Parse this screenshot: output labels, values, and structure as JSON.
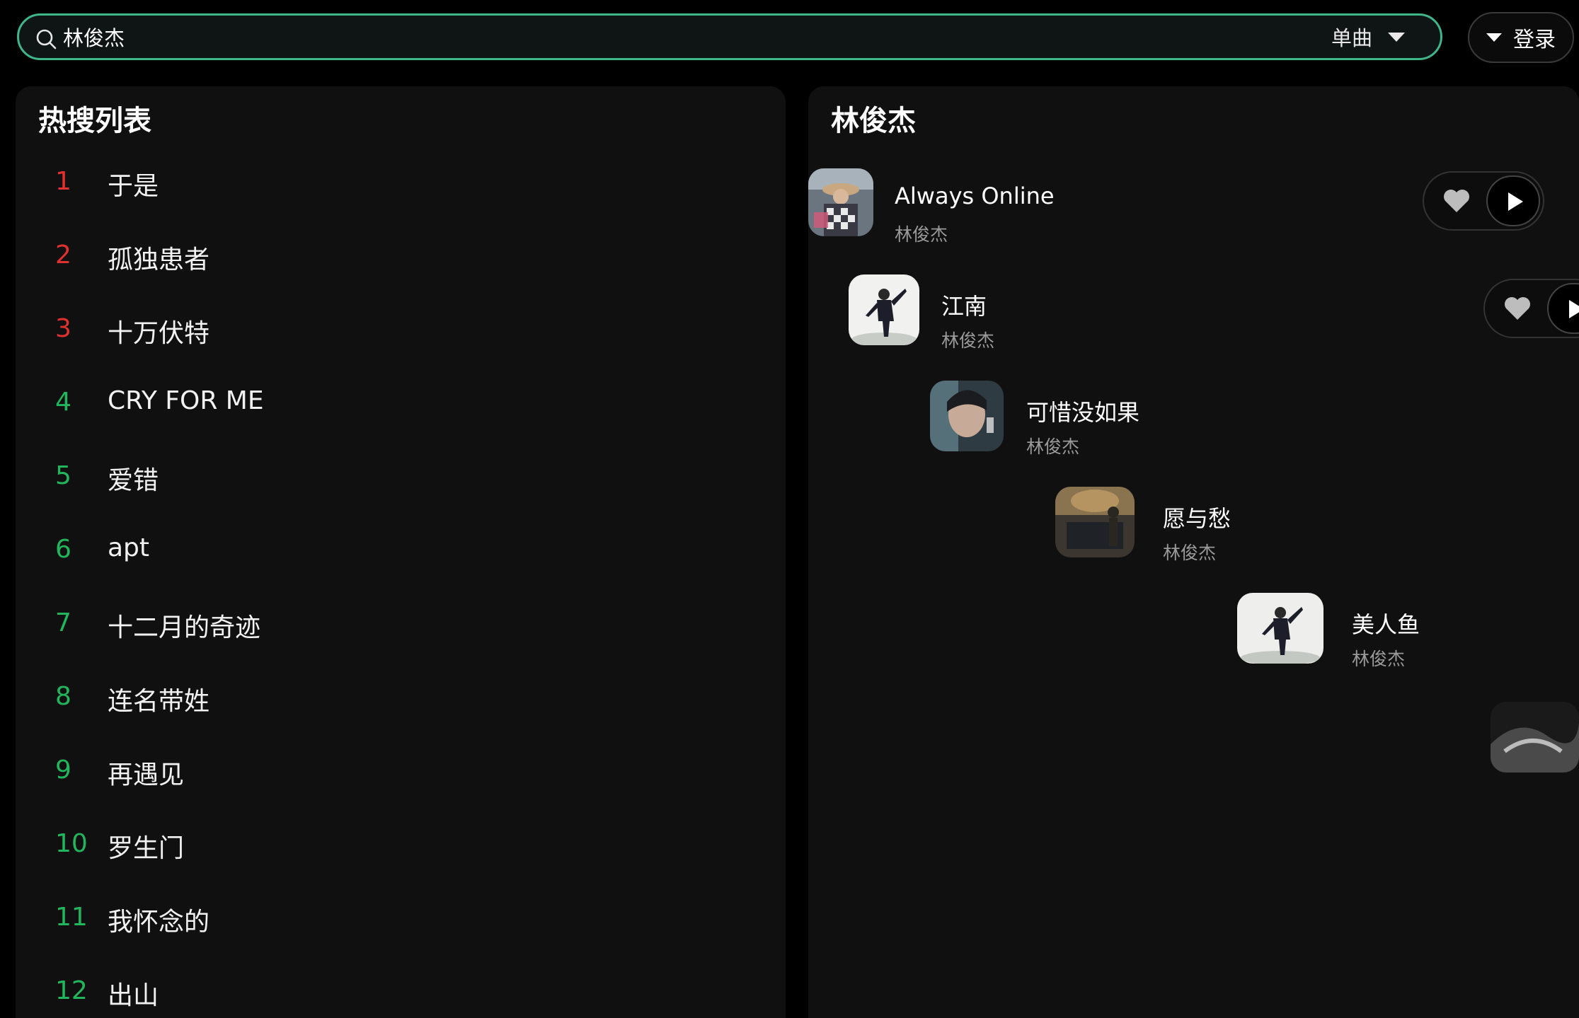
{
  "search": {
    "value": "林俊杰",
    "type_label": "单曲"
  },
  "login": {
    "label": "登录"
  },
  "hot_list": {
    "title": "热搜列表",
    "items": [
      {
        "rank": "1",
        "title": "于是"
      },
      {
        "rank": "2",
        "title": "孤独患者"
      },
      {
        "rank": "3",
        "title": "十万伏特"
      },
      {
        "rank": "4",
        "title": "CRY FOR ME"
      },
      {
        "rank": "5",
        "title": "爱错"
      },
      {
        "rank": "6",
        "title": "apt"
      },
      {
        "rank": "7",
        "title": "十二月的奇迹"
      },
      {
        "rank": "8",
        "title": "连名带姓"
      },
      {
        "rank": "9",
        "title": "再遇见"
      },
      {
        "rank": "10",
        "title": "罗生门"
      },
      {
        "rank": "11",
        "title": "我怀念的"
      },
      {
        "rank": "12",
        "title": "出山"
      }
    ]
  },
  "results": {
    "title": "林俊杰",
    "songs": [
      {
        "title": "Always Online",
        "artist": "林俊杰"
      },
      {
        "title": "江南",
        "artist": "林俊杰"
      },
      {
        "title": "可惜没如果",
        "artist": "林俊杰"
      },
      {
        "title": "愿与愁",
        "artist": "林俊杰"
      },
      {
        "title": "美人鱼",
        "artist": "林俊杰"
      }
    ]
  },
  "icons": {
    "search": "search-icon",
    "dropdown": "caret-down-icon",
    "like": "heart-icon",
    "play": "play-icon"
  },
  "colors": {
    "accent": "#3fb58a",
    "rank_top": "#e03131",
    "rank_rest": "#21b55c",
    "panel": "#101010"
  }
}
